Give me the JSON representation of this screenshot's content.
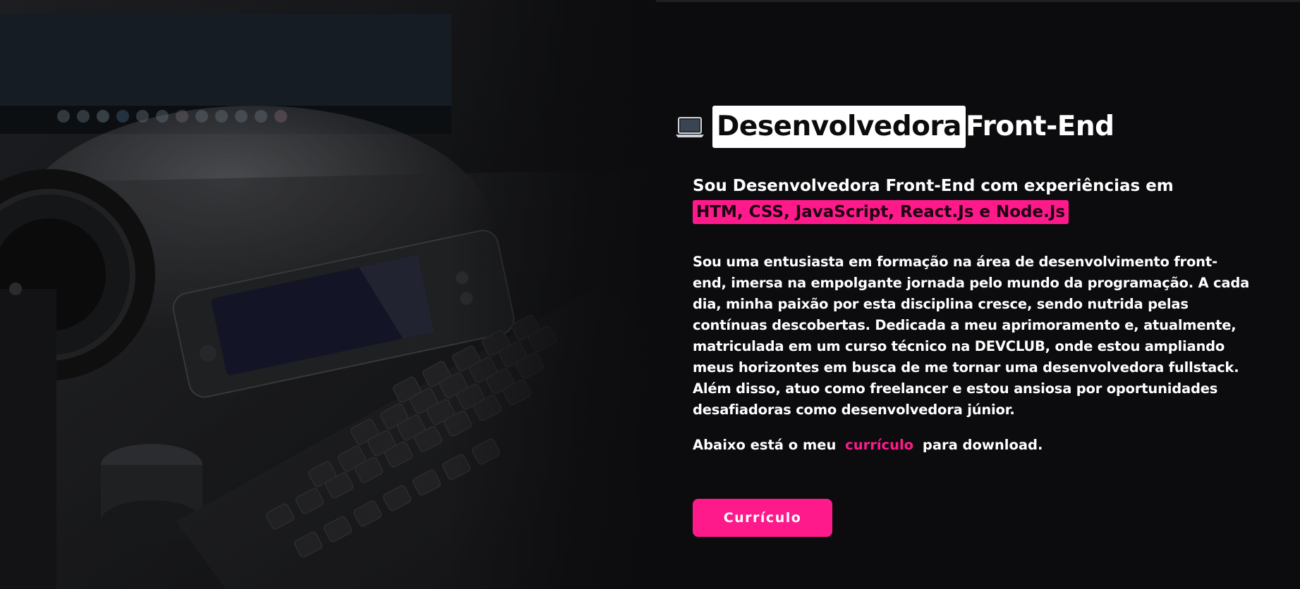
{
  "colors": {
    "background": "#0c0c0e",
    "accent": "#ff1a8c",
    "text": "#ffffff",
    "highlight_bg": "#ffffff"
  },
  "hero": {
    "image": "desk-keyboard-photo",
    "title": {
      "icon": "laptop-icon",
      "highlight": "Desenvolvedora",
      "rest": "Front-End"
    },
    "subtitle": {
      "text": "Sou Desenvolvedora Front-End com experiências em",
      "stack": "HTM, CSS, JavaScript, React.Js e Node.Js"
    },
    "about": "Sou uma entusiasta em formação na área de desenvolvimento front-end, imersa na empolgante jornada pelo mundo da programação. A cada dia, minha paixão por esta disciplina cresce, sendo nutrida pelas contínuas descobertas. Dedicada a meu aprimoramento e, atualmente, matriculada em um curso técnico na DEVCLUB, onde estou ampliando meus horizontes em busca de me tornar uma desenvolvedora fullstack. Além disso, atuo como freelancer e estou ansiosa por oportunidades desafiadoras como desenvolvedora júnior.",
    "download": {
      "before": "Abaixo está o meu",
      "link": "currículo",
      "after": "para download."
    },
    "button_label": "Currículo"
  }
}
